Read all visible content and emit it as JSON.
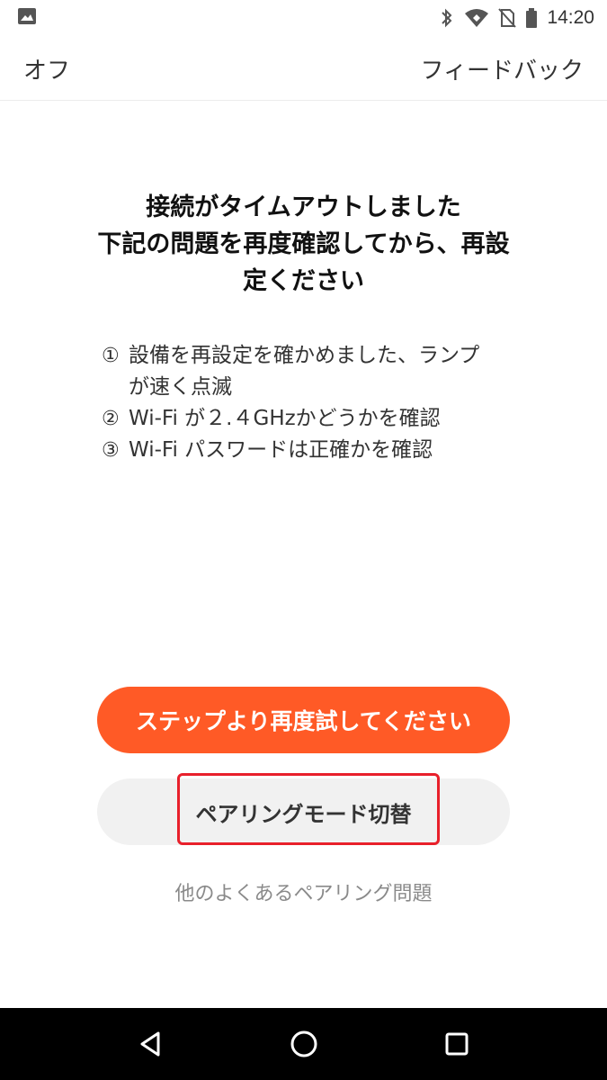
{
  "status_bar": {
    "time": "14:20",
    "icons": [
      "image-icon",
      "bluetooth-icon",
      "wifi-icon",
      "no-sim-icon",
      "battery-icon"
    ]
  },
  "header": {
    "left_label": "オフ",
    "right_label": "フィードバック"
  },
  "message": {
    "title_lines": [
      "接続がタイムアウトしました",
      "下記の問題を再度確認してから、再設",
      "定ください"
    ],
    "checklist": [
      {
        "num": "①",
        "text": "設備を再設定を確かめました、ランプが速く点滅"
      },
      {
        "num": "②",
        "text": "Wi-Fi が２.４GHzかどうかを確認"
      },
      {
        "num": "③",
        "text": "Wi-Fi パスワードは正確かを確認"
      }
    ]
  },
  "actions": {
    "primary_label": "ステップより再度試してください",
    "secondary_label": "ペアリングモード切替",
    "other_link": "他のよくあるペアリング問題"
  },
  "nav_bar": {
    "icons": [
      "back-icon",
      "home-icon",
      "recent-apps-icon"
    ]
  },
  "colors": {
    "accent": "#ff5a26",
    "highlight": "#e8202b",
    "secondary_bg": "#f1f1f1"
  }
}
